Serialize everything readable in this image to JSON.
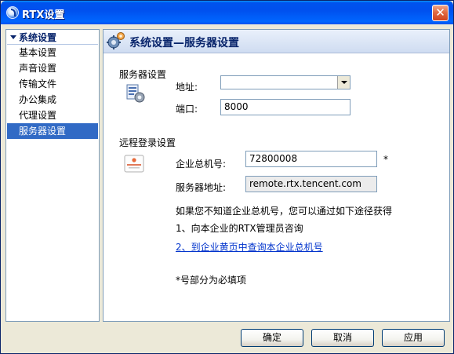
{
  "window": {
    "title": "RTX设置",
    "close_glyph": "✕"
  },
  "sidebar": {
    "root_label": "系统设置",
    "items": [
      {
        "label": "基本设置",
        "selected": false
      },
      {
        "label": "声音设置",
        "selected": false
      },
      {
        "label": "传输文件",
        "selected": false
      },
      {
        "label": "办公集成",
        "selected": false
      },
      {
        "label": "代理设置",
        "selected": false
      },
      {
        "label": "服务器设置",
        "selected": true
      }
    ]
  },
  "header": {
    "title": "系统设置—服务器设置",
    "icon": "gears-icon"
  },
  "server_group": {
    "label": "服务器设置",
    "icon": "server-settings-icon",
    "address_label": "地址:",
    "address_value": "",
    "port_label": "端口:",
    "port_value": "8000"
  },
  "remote_group": {
    "label": "远程登录设置",
    "icon": "remote-login-icon",
    "enterprise_label": "企业总机号:",
    "enterprise_value": "72800008",
    "required_mark": "*",
    "server_addr_label": "服务器地址:",
    "server_addr_value": "remote.rtx.tencent.com",
    "hint": "如果您不知道企业总机号，您可以通过如下途径获得",
    "option1": "1、向本企业的RTX管理员咨询",
    "option2_link": "2、到企业黄页中查询本企业总机号",
    "required_note": "*号部分为必填项"
  },
  "buttons": {
    "ok": "确定",
    "cancel": "取消",
    "apply": "应用"
  },
  "colors": {
    "selection": "#316ac5",
    "link": "#0033cc",
    "title_bar": "#0053ee"
  }
}
